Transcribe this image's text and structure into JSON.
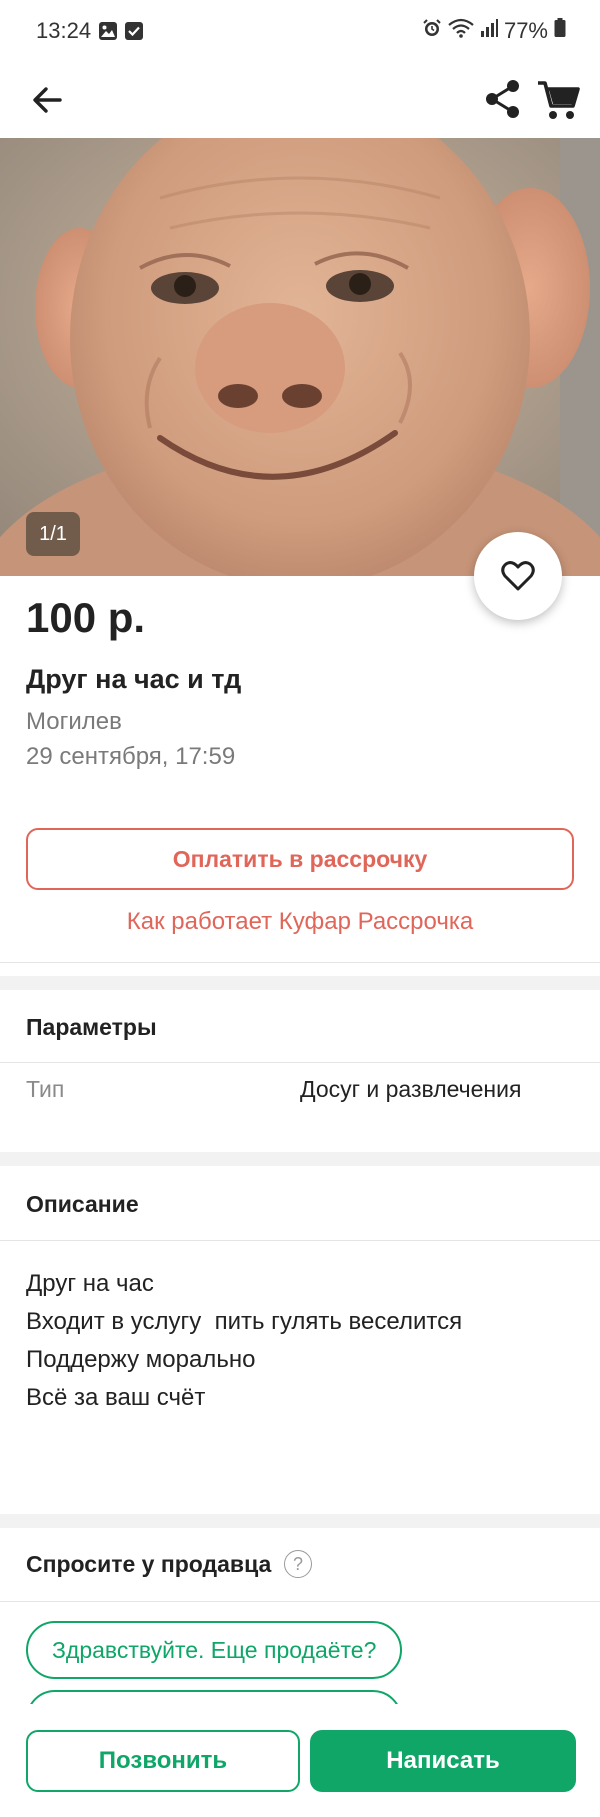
{
  "status_bar": {
    "time": "13:24",
    "battery": "77%",
    "left_icons": [
      "gallery-icon",
      "checkbox-icon"
    ],
    "right_icons": [
      "alarm-icon",
      "wifi-icon",
      "signal-icon",
      "battery-icon"
    ]
  },
  "top_bar": {
    "icons": [
      "back-arrow-icon",
      "share-icon",
      "cart-icon"
    ]
  },
  "gallery": {
    "counter": "1/1"
  },
  "listing": {
    "price": "100 р.",
    "title": "Друг на час и тд",
    "city": "Могилев",
    "date": "29 сентября, 17:59"
  },
  "installment": {
    "button_label": "Оплатить в рассрочку",
    "link_label": "Как работает Куфар Рассрочка"
  },
  "parameters": {
    "title": "Параметры",
    "rows": [
      {
        "label": "Тип",
        "value": "Досуг и развлечения"
      }
    ]
  },
  "description": {
    "title": "Описание",
    "lines": [
      "Друг на час",
      "Входит в услугу  пить гулять веселится",
      "Поддержу морально",
      "Всё за ваш счёт"
    ]
  },
  "ask_seller": {
    "title": "Спросите у продавца",
    "help_symbol": "?",
    "chips": [
      "Здравствуйте. Еще продаёте?"
    ]
  },
  "bottom_bar": {
    "call_label": "Позвонить",
    "write_label": "Написать"
  },
  "colors": {
    "accent_green": "#0fa668",
    "accent_red": "#e0665a"
  }
}
